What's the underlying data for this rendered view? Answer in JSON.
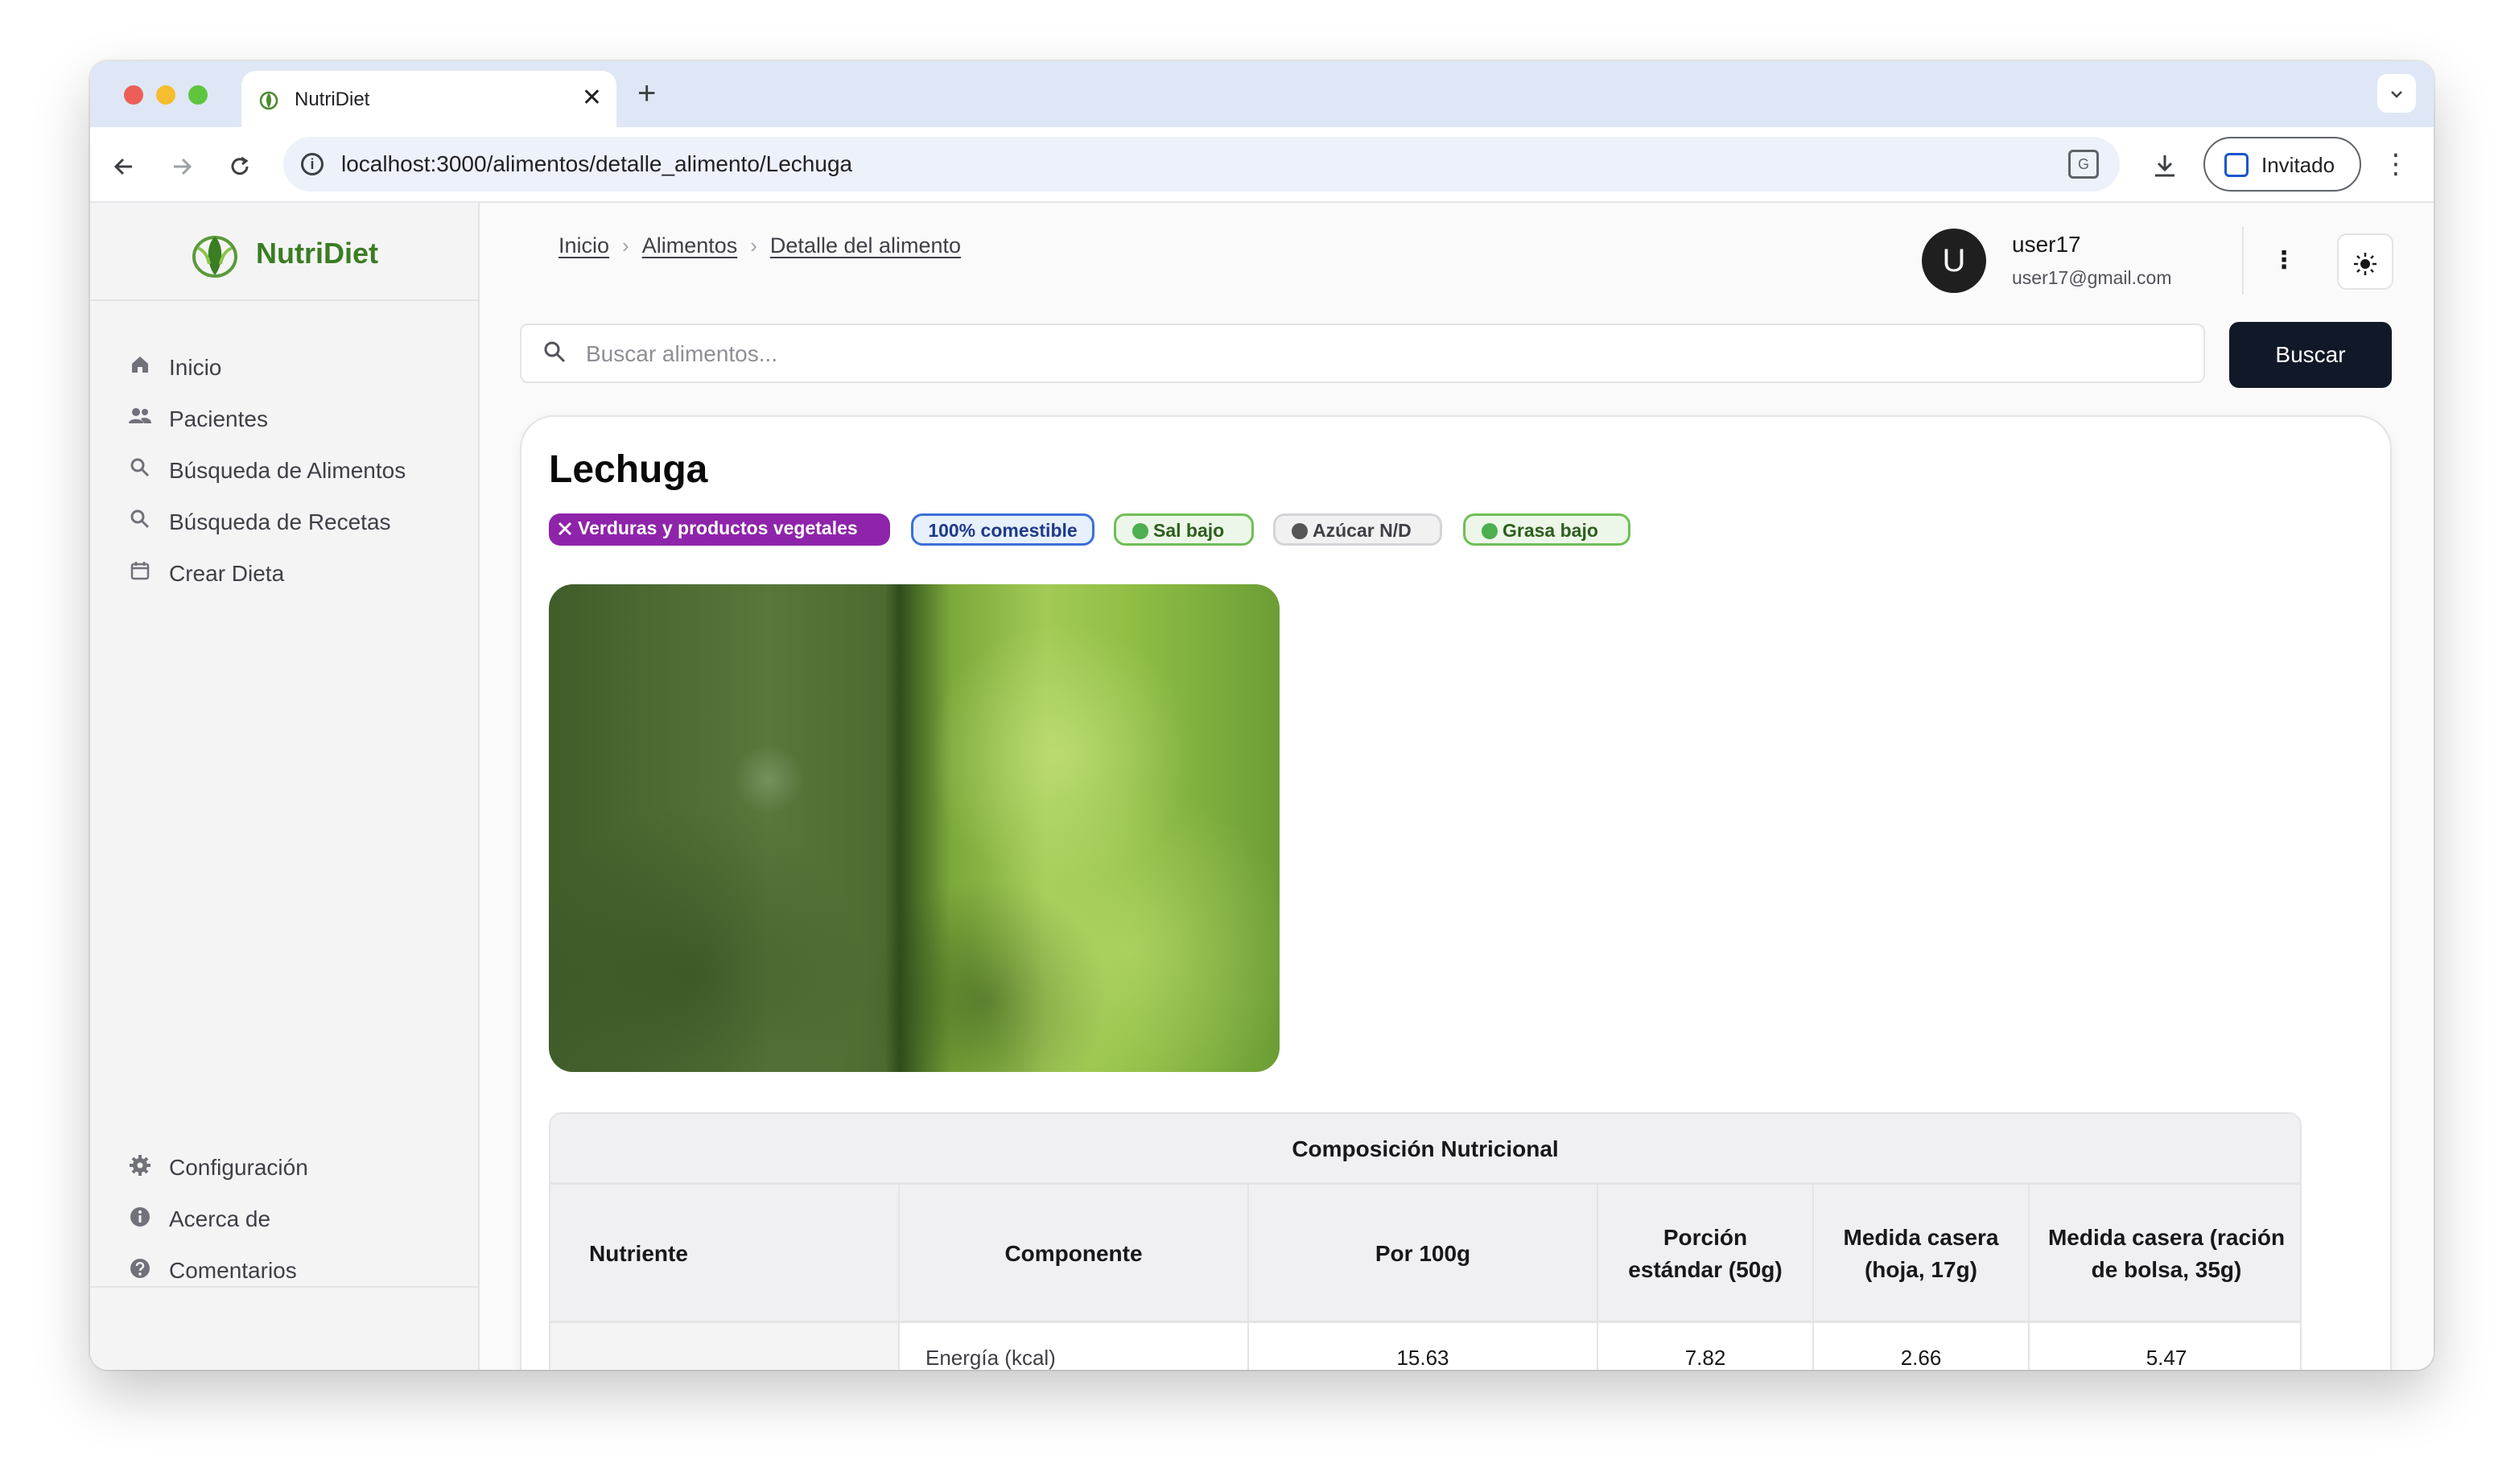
{
  "browser": {
    "tab_title": "NutriDiet",
    "tab_close": "✕",
    "new_tab": "+",
    "url": "localhost:3000/alimentos/detalle_alimento/Lechuga",
    "profile_label": "Invitado"
  },
  "sidebar": {
    "brand": "NutriDiet",
    "nav": [
      {
        "label": "Inicio",
        "icon": "home-icon"
      },
      {
        "label": "Pacientes",
        "icon": "users-icon"
      },
      {
        "label": "Búsqueda de Alimentos",
        "icon": "search-icon"
      },
      {
        "label": "Búsqueda de Recetas",
        "icon": "search-icon"
      },
      {
        "label": "Crear Dieta",
        "icon": "calendar-icon"
      }
    ],
    "footer_nav": [
      {
        "label": "Configuración",
        "icon": "gear-icon"
      },
      {
        "label": "Acerca de",
        "icon": "info-icon"
      },
      {
        "label": "Comentarios",
        "icon": "help-icon"
      }
    ]
  },
  "header": {
    "breadcrumb": [
      "Inicio",
      "Alimentos",
      "Detalle del alimento"
    ],
    "user": {
      "initial": "U",
      "name": "user17",
      "email": "user17@gmail.com"
    }
  },
  "search": {
    "placeholder": "Buscar alimentos...",
    "button": "Buscar"
  },
  "food": {
    "name": "Lechuga",
    "badges": {
      "category": "Verduras y productos vegetales",
      "edible": "100% comestible",
      "salt": "Sal bajo",
      "sugar": "Azúcar N/D",
      "fat": "Grasa bajo"
    },
    "badge_colors": {
      "category": "#8e24aa",
      "edible": "#3b6fd8",
      "low": "#4caf50",
      "na": "#555555"
    }
  },
  "table": {
    "title": "Composición Nutricional",
    "headers": [
      "Nutriente",
      "Componente",
      "Por 100g",
      "Porción estándar (50g)",
      "Medida casera (hoja, 17g)",
      "Medida casera (ración de bolsa, 35g)"
    ],
    "rows": [
      {
        "nutrient": "",
        "component": "Energía (kcal)",
        "per100": "15.63",
        "portion": "7.82",
        "leaf": "2.66",
        "bag": "5.47"
      }
    ]
  }
}
